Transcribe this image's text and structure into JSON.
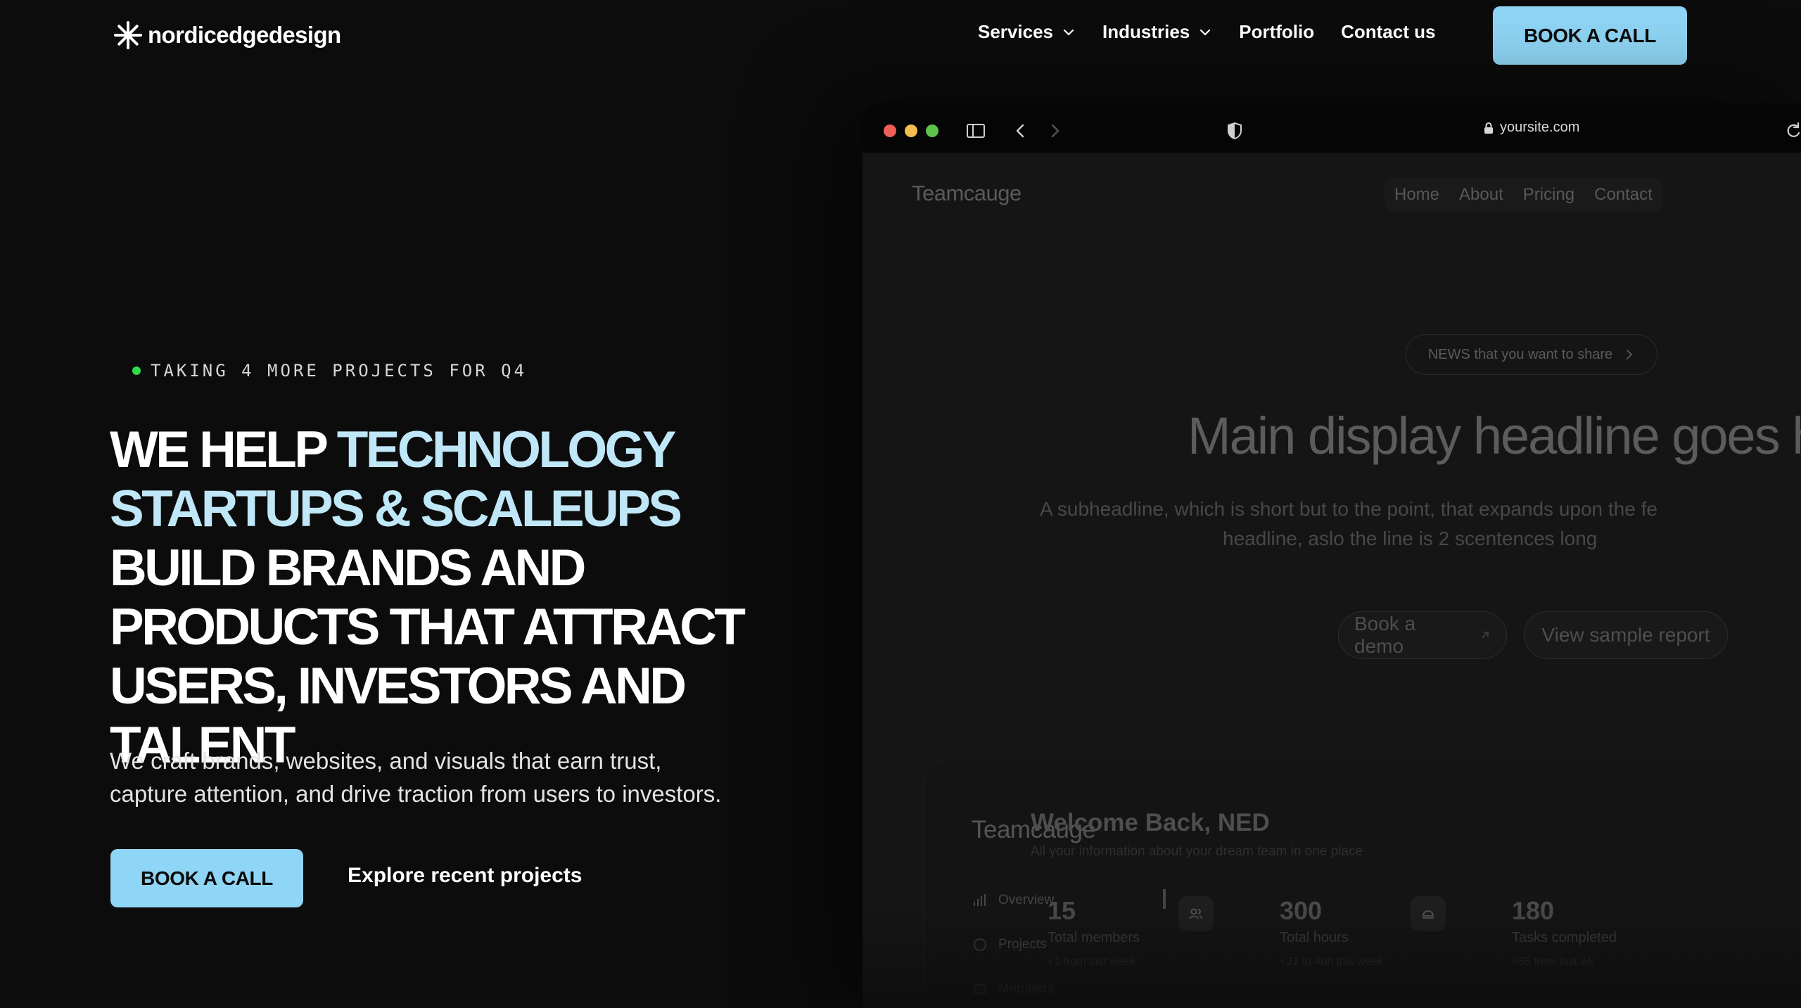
{
  "brand": {
    "name": "nordicedgedesign",
    "accent": "#8fd5f5",
    "highlight": "#bfe7f8",
    "status_dot": "#2fdc4a"
  },
  "nav": {
    "items": [
      {
        "label": "Services",
        "has_dropdown": true
      },
      {
        "label": "Industries",
        "has_dropdown": true
      },
      {
        "label": "Portfolio",
        "has_dropdown": false
      },
      {
        "label": "Contact us",
        "has_dropdown": false
      }
    ],
    "cta": "BOOK A CALL"
  },
  "hero": {
    "eyebrow": "TAKING 4 MORE PROJECTS FOR Q4",
    "headline": {
      "part1": "WE HELP ",
      "part2": "TECHNOLOGY STARTUPS & SCALEUPS",
      "part3": " BUILD BRANDS AND PRODUCTS THAT ATTRACT USERS, INVESTORS AND TALENT"
    },
    "subtext_line1": "We craft brands, websites, and visuals that earn trust,",
    "subtext_line2": "capture attention, and drive traction from users to investors.",
    "cta": "BOOK A CALL",
    "secondary": "Explore recent projects"
  },
  "browser": {
    "url": "yoursite.com",
    "site": {
      "logo": "Teamcauge",
      "nav": [
        "Home",
        "About",
        "Pricing",
        "Contact"
      ],
      "news": "NEWS that you want to share",
      "headline": "Main display headline goes h",
      "sub_line1": "A subheadline, which is short but to the point, that expands upon the fe",
      "sub_line2": "headline, aslo the line is 2 scentences long",
      "btn_demo": "Book a demo",
      "btn_report": "View sample report"
    },
    "dashboard": {
      "logo": "Teamcauge",
      "menu": [
        "Overview",
        "Projects",
        "Members"
      ],
      "title": "Welcome Back, NED",
      "subtitle": "All your information about your dream team in one place",
      "stats": [
        {
          "value": "15",
          "label": "Total members",
          "trend": "+1 from last week"
        },
        {
          "value": "300",
          "label": "Total hours",
          "trend": "+21 to 40h this week"
        },
        {
          "value": "180",
          "label": "Tasks completed",
          "trend": "+55 from last wk"
        }
      ]
    }
  }
}
